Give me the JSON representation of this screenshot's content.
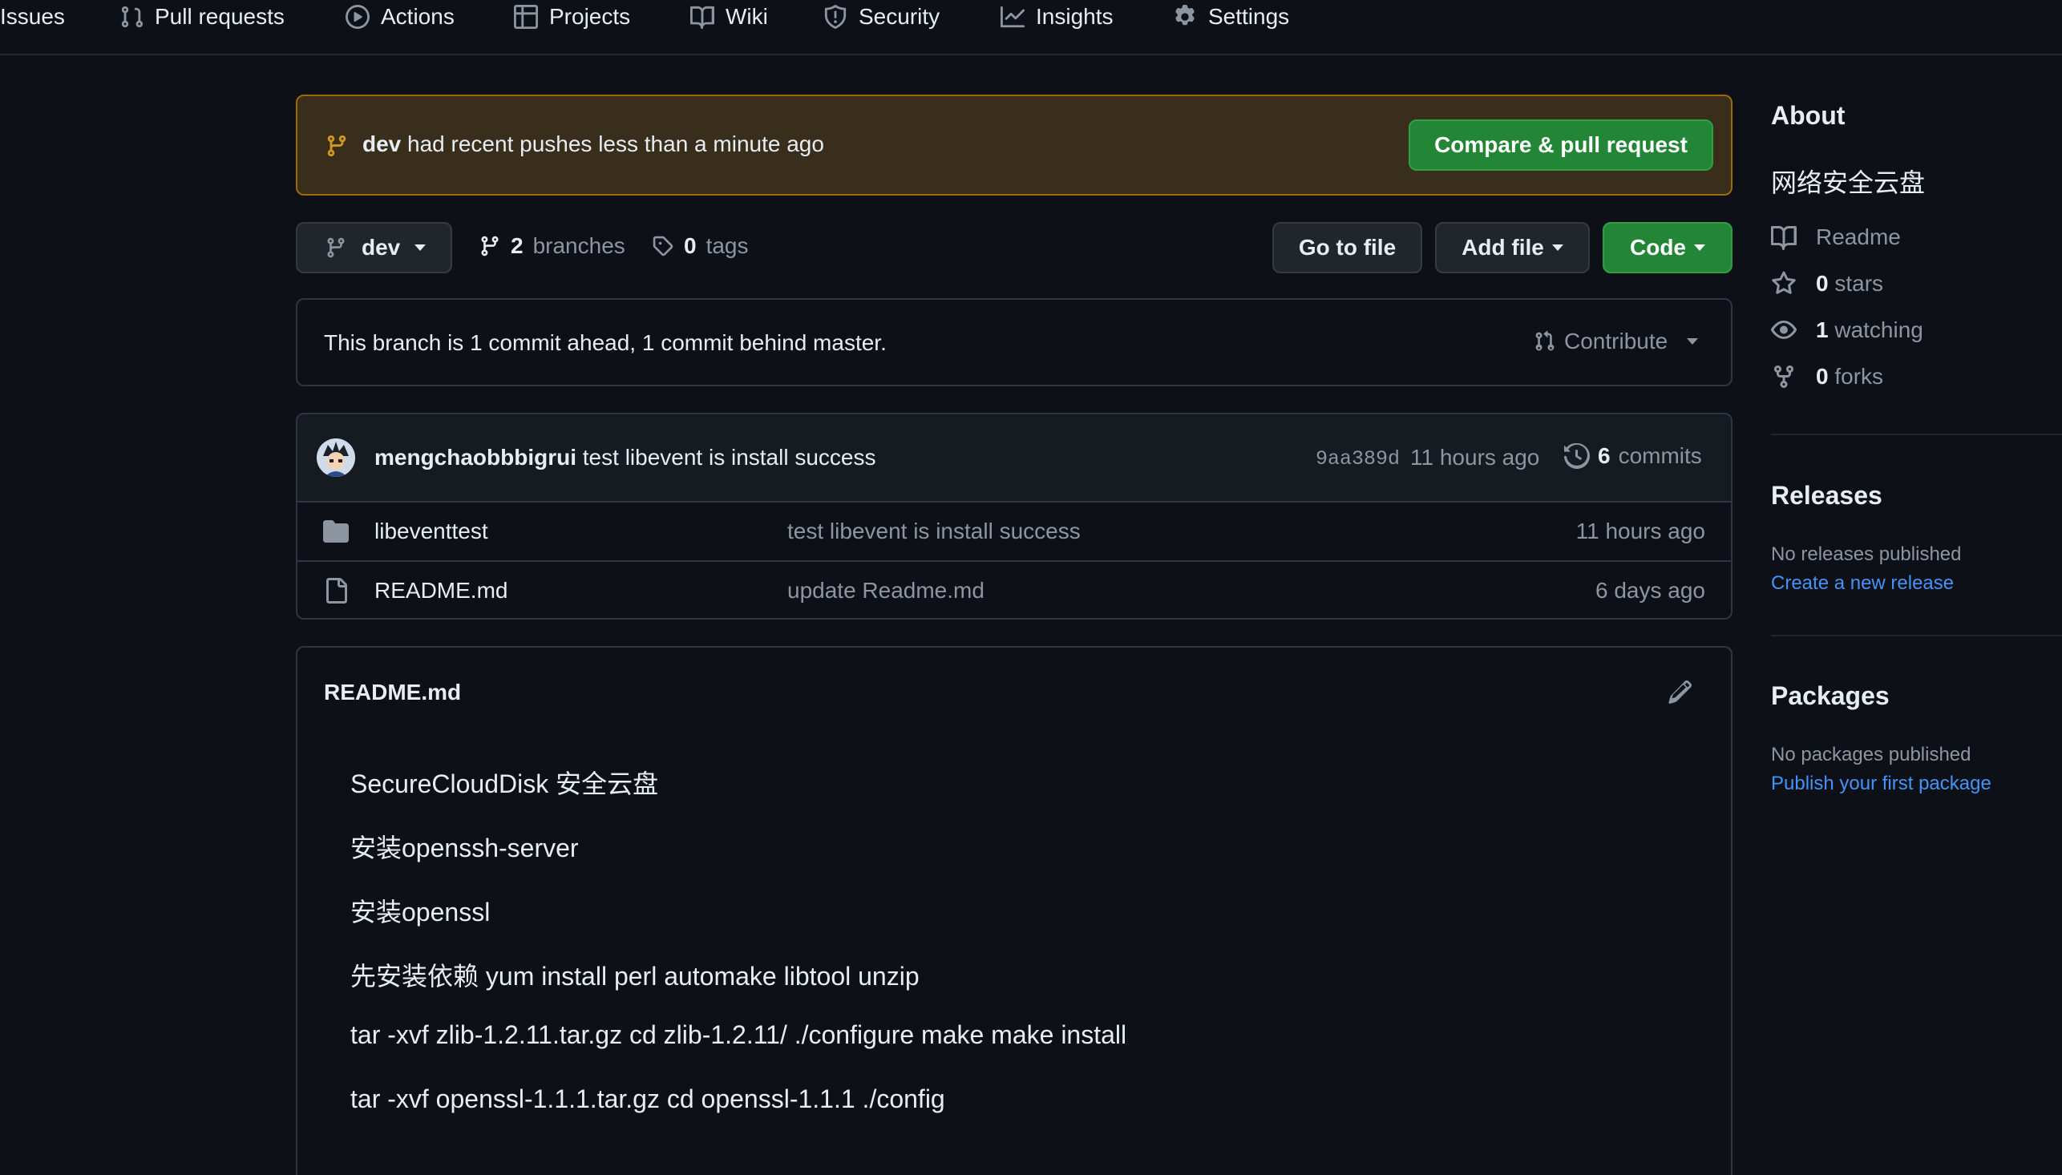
{
  "nav": {
    "issues": "Issues",
    "pull_requests": "Pull requests",
    "actions": "Actions",
    "projects": "Projects",
    "wiki": "Wiki",
    "security": "Security",
    "insights": "Insights",
    "settings": "Settings"
  },
  "banner": {
    "branch": "dev",
    "message": "had recent pushes less than a minute ago",
    "button": "Compare & pull request"
  },
  "toolbar": {
    "branch": "dev",
    "branches_count": "2",
    "branches_label": "branches",
    "tags_count": "0",
    "tags_label": "tags",
    "go_to_file": "Go to file",
    "add_file": "Add file",
    "code": "Code"
  },
  "compare": {
    "message": "This branch is 1 commit ahead, 1 commit behind master.",
    "contribute": "Contribute"
  },
  "commit": {
    "author": "mengchaobbbigrui",
    "message": "test libevent is install success",
    "sha": "9aa389d",
    "time": "11 hours ago",
    "commits_count": "6",
    "commits_label": "commits"
  },
  "files": [
    {
      "name": "libeventtest",
      "type": "folder",
      "message": "test libevent is install success",
      "time": "11 hours ago"
    },
    {
      "name": "README.md",
      "type": "file",
      "message": "update Readme.md",
      "time": "6 days ago"
    }
  ],
  "readme": {
    "title": "README.md",
    "lines": [
      "SecureCloudDisk 安全云盘",
      "安装openssh-server",
      "安装openssl",
      "先安装依赖 yum install perl automake libtool unzip",
      "tar -xvf zlib-1.2.11.tar.gz cd zlib-1.2.11/ ./configure make make install",
      "tar -xvf openssl-1.1.1.tar.gz cd openssl-1.1.1 ./config"
    ]
  },
  "about": {
    "heading": "About",
    "description": "网络安全云盘",
    "readme": "Readme",
    "stars_count": "0",
    "stars_label": "stars",
    "watching_count": "1",
    "watching_label": "watching",
    "forks_count": "0",
    "forks_label": "forks"
  },
  "releases": {
    "heading": "Releases",
    "empty": "No releases published",
    "link": "Create a new release"
  },
  "packages": {
    "heading": "Packages",
    "empty": "No packages published",
    "link": "Publish your first package"
  },
  "colors": {
    "background": "#0d1117",
    "border": "#30363d",
    "accent_green": "#238636",
    "link_blue": "#4493f8",
    "banner_bg": "#392d1b",
    "banner_border": "#9e6a03",
    "warning_icon": "#d29922"
  }
}
